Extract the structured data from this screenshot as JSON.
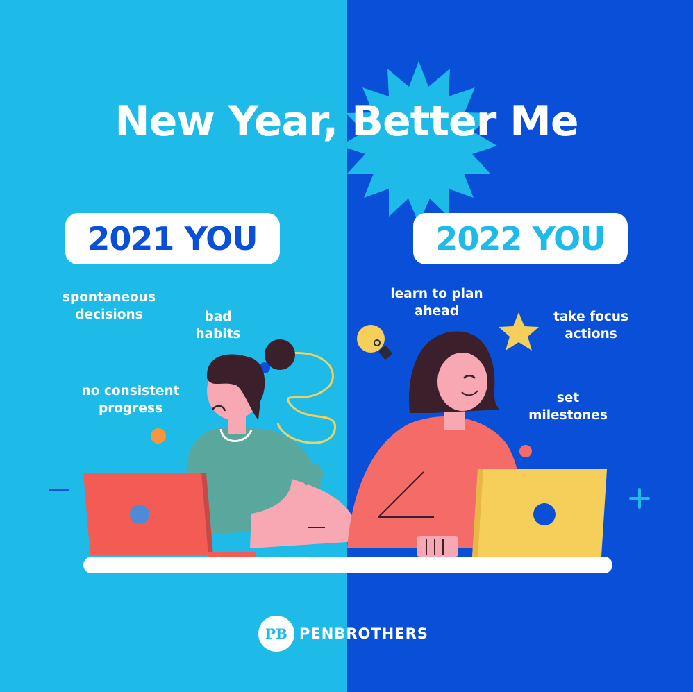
{
  "title": "New Year, Better Me",
  "left": {
    "badge": "2021 YOU",
    "traits": [
      "spontaneous decisions",
      "bad habits",
      "no consistent progress"
    ]
  },
  "right": {
    "badge": "2022 YOU",
    "traits": [
      "learn to plan ahead",
      "take focus actions",
      "set milestones"
    ]
  },
  "signs": {
    "minus": "minus-icon",
    "plus": "plus-icon"
  },
  "logo": {
    "badge_text": "PB",
    "name": "PENBROTHERS"
  },
  "colors": {
    "left_bg": "#1fbbe8",
    "right_bg": "#0a4fd8",
    "accent_red": "#f25c54",
    "accent_yellow": "#f6cf5a"
  }
}
